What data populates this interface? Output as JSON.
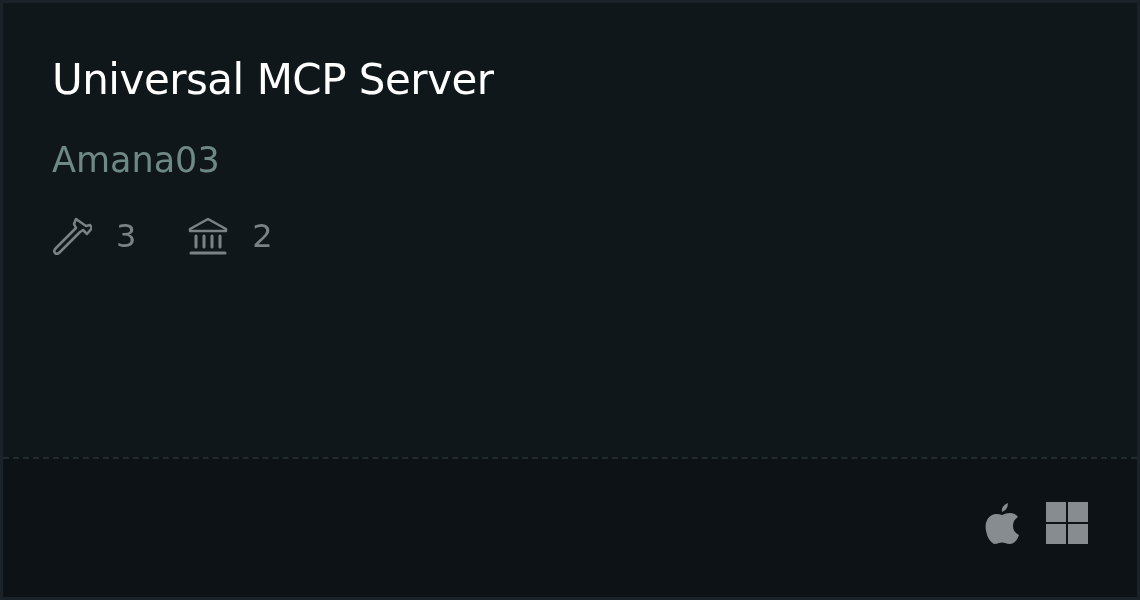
{
  "card": {
    "title": "Universal MCP Server",
    "author": "Amana03",
    "stats": [
      {
        "kind": "tools",
        "count": "3"
      },
      {
        "kind": "resources",
        "count": "2"
      }
    ],
    "platforms": [
      {
        "kind": "apple"
      },
      {
        "kind": "windows"
      }
    ]
  }
}
